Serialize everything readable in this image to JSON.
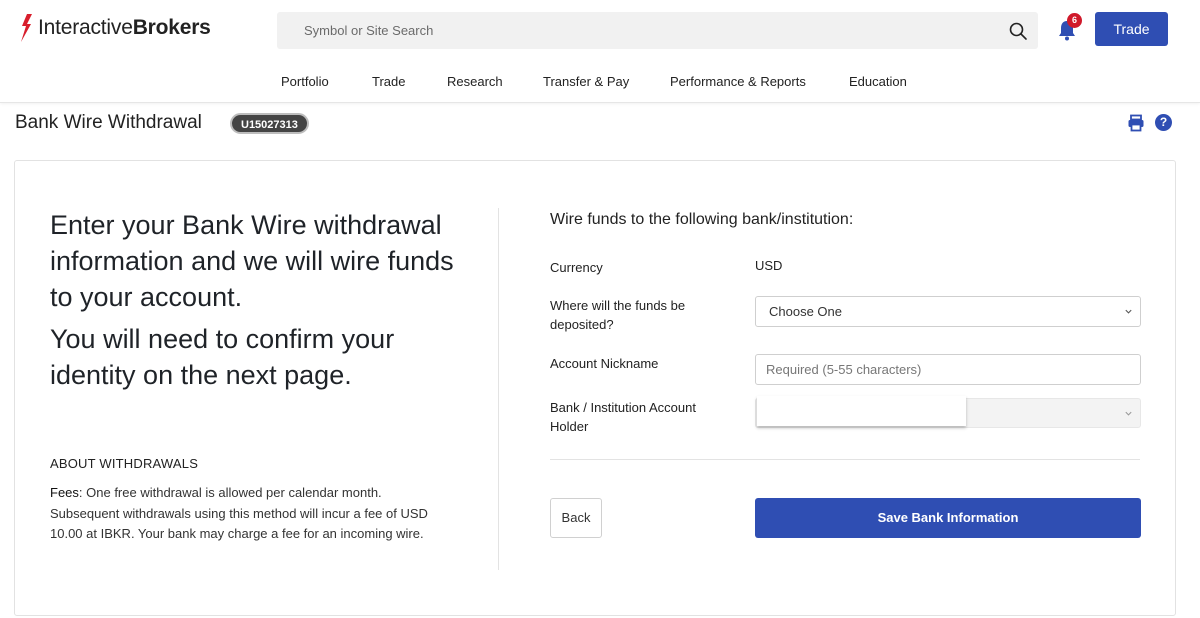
{
  "header": {
    "brand_part1": "Interactive",
    "brand_part2": "Brokers",
    "search_placeholder": "Symbol or Site Search",
    "notifications_count": "6",
    "trade_button": "Trade"
  },
  "nav": {
    "items": [
      "Portfolio",
      "Trade",
      "Research",
      "Transfer & Pay",
      "Performance & Reports",
      "Education"
    ]
  },
  "page": {
    "title": "Bank Wire Withdrawal",
    "account_id": "U15027313"
  },
  "intro": {
    "lead_1": "Enter your Bank Wire withdrawal information and we will wire funds to your account.",
    "lead_2": "You will need to confirm your identity on the next page.",
    "about_title": "ABOUT WITHDRAWALS",
    "fees_label": "Fees",
    "fees_text": ": One free withdrawal is allowed per calendar month. Subsequent withdrawals using this method will incur a fee of USD 10.00 at IBKR. Your bank may charge a fee for an incoming wire."
  },
  "form": {
    "heading": "Wire funds to the following bank/institution:",
    "currency_label": "Currency",
    "currency_value": "USD",
    "deposit_label": "Where will the funds be deposited?",
    "deposit_value": "Choose One",
    "nickname_label": "Account Nickname",
    "nickname_placeholder": "Required (5-55 characters)",
    "holder_label": "Bank / Institution Account Holder",
    "back_button": "Back",
    "save_button": "Save Bank Information"
  },
  "colors": {
    "primary": "#2f4eb3",
    "badge": "#d0192b",
    "logo_red": "#d81e2c"
  }
}
